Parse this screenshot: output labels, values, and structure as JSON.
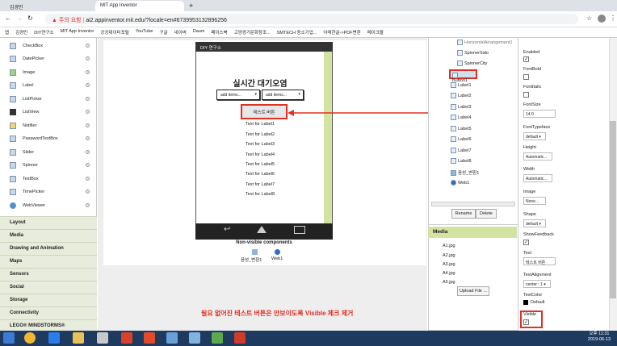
{
  "browser": {
    "tabs": [
      {
        "label": "김경민"
      },
      {
        "label": "MIT App Inventor"
      }
    ],
    "new_tab": "+",
    "warning_text": "주의 요함",
    "url": "ai2.appinventor.mit.edu/?locale=en#6739953132896256",
    "bookmarks": [
      "앱",
      "김경민",
      "DIY연구소",
      "MIT App Inventor",
      "공공데이터포털",
      "YouTube",
      "구글",
      "네이버",
      "Daum",
      "페이스북",
      "고양경기문화창조...",
      "SMTECH 중소기업...",
      "아래한글->PDF변환",
      "메이크올"
    ]
  },
  "palette": {
    "items": [
      {
        "label": "CheckBox"
      },
      {
        "label": "DatePicker"
      },
      {
        "label": "Image"
      },
      {
        "label": "Label"
      },
      {
        "label": "ListPicker"
      },
      {
        "label": "ListView"
      },
      {
        "label": "Notifier"
      },
      {
        "label": "PasswordTextBox"
      },
      {
        "label": "Slider"
      },
      {
        "label": "Spinner"
      },
      {
        "label": "TextBox"
      },
      {
        "label": "TimePicker"
      },
      {
        "label": "WebViewer"
      }
    ],
    "categories": [
      {
        "label": "Layout"
      },
      {
        "label": "Media"
      },
      {
        "label": "Drawing and Animation"
      },
      {
        "label": "Maps"
      },
      {
        "label": "Sensors"
      },
      {
        "label": "Social"
      },
      {
        "label": "Storage"
      },
      {
        "label": "Connectivity"
      },
      {
        "label": "LEGO® MINDSTORMS®"
      }
    ]
  },
  "viewer": {
    "screen_title": "DIY 연구소",
    "app_title": "실시간 대기오염",
    "spinner1": "add items...",
    "spinner2": "add items...",
    "test_button": "테스트 버튼",
    "labels": [
      "Text for Label1",
      "Text for Label2",
      "Text for Label3",
      "Text for Label4",
      "Text for Label5",
      "Text for Label6",
      "Text for Label7",
      "Text for Label8"
    ],
    "nonvisible_title": "Non-visible components",
    "nonvisible": [
      "음성_변환1",
      "Web1"
    ]
  },
  "components": {
    "nodes": [
      {
        "label": "HorizontalArrangement1"
      },
      {
        "label": "SpinnerSido"
      },
      {
        "label": "SpinnerCity"
      },
      {
        "label": "Button1"
      },
      {
        "label": "Label1"
      },
      {
        "label": "Label2"
      },
      {
        "label": "Label3"
      },
      {
        "label": "Label4"
      },
      {
        "label": "Label5"
      },
      {
        "label": "Label6"
      },
      {
        "label": "Label7"
      },
      {
        "label": "Label8"
      },
      {
        "label": "음성_변환1"
      },
      {
        "label": "Web1"
      }
    ],
    "rename": "Rename",
    "delete": "Delete"
  },
  "media": {
    "title": "Media",
    "files": [
      "A1.jpg",
      "A2.jpg",
      "A3.jpg",
      "A4.jpg",
      "A5.jpg"
    ],
    "upload": "Upload File ..."
  },
  "properties": {
    "enabled": "Enabled",
    "fontbold": "FontBold",
    "fontitalic": "FontItalic",
    "fontsize": "FontSize",
    "fontsize_value": "14.0",
    "fonttypeface": "FontTypeface",
    "fonttypeface_value": "default ▾",
    "height": "Height",
    "height_value": "Automatic...",
    "width": "Width",
    "width_value": "Automatic...",
    "image": "Image",
    "image_value": "None...",
    "shape": "Shape",
    "shape_value": "default ▾",
    "showfeedback": "ShowFeedback",
    "text": "Text",
    "text_value": "테스트 버튼",
    "textalignment": "TextAlignment",
    "textalignment_value": "center : 1 ▾",
    "textcolor": "TextColor",
    "textcolor_value": "Default",
    "visible": "Visible"
  },
  "annotation": "필요 없어진 테스트 버튼은 안보이도록 Visible 체크 제거",
  "taskbar": {
    "time": "오후 11:31",
    "date": "2019-06-13"
  },
  "colors": {
    "highlight": "#e03020",
    "app_green": "#d5e3a2"
  }
}
